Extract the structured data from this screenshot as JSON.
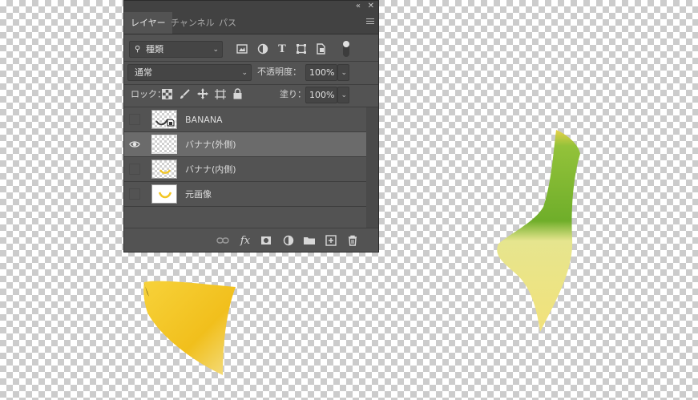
{
  "panel": {
    "tabs": [
      {
        "label": "レイヤー",
        "active": true
      },
      {
        "label": "チャンネル",
        "active": false
      },
      {
        "label": "パス",
        "active": false
      }
    ],
    "filter": {
      "label": "種類"
    },
    "blend_mode": "通常",
    "opacity": {
      "label": "不透明度：",
      "value": "100%"
    },
    "lock": {
      "label": "ロック："
    },
    "fill": {
      "label": "塗り：",
      "value": "100%"
    },
    "layers": [
      {
        "name": "BANANA",
        "visible": false,
        "selected": false,
        "kind": "smart-object"
      },
      {
        "name": "バナナ(外側)",
        "visible": true,
        "selected": true,
        "kind": "pixel"
      },
      {
        "name": "バナナ(内側)",
        "visible": false,
        "selected": false,
        "kind": "pixel"
      },
      {
        "name": "元画像",
        "visible": false,
        "selected": false,
        "kind": "pixel"
      }
    ],
    "footer_icons": [
      "link-icon",
      "fx-icon",
      "mask-icon",
      "adjustment-icon",
      "folder-icon",
      "new-layer-icon",
      "trash-icon"
    ]
  },
  "colors": {
    "panel_bg": "#535353",
    "selected_row": "#6b6b6b",
    "banana_yellow": "#f2c623",
    "banana_stem": "#7fb82e"
  }
}
